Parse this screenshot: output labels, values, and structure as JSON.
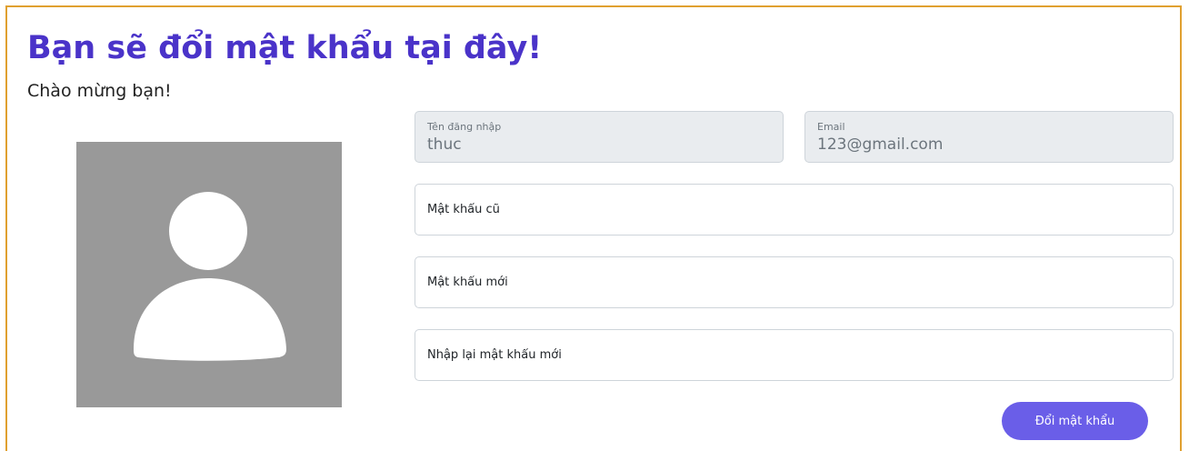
{
  "header": {
    "title": "Bạn sẽ đổi mật khẩu tại đây!",
    "greeting": "Chào mừng bạn!"
  },
  "colors": {
    "title": "#4a33c9",
    "frame_border": "#e0a030",
    "button": "#6a5ee8",
    "avatar_bg": "#999999",
    "readonly_bg": "#e9ecef"
  },
  "avatar": {
    "icon": "user-placeholder-icon"
  },
  "form": {
    "username": {
      "label": "Tên đăng nhập",
      "value": "thuc"
    },
    "email": {
      "label": "Email",
      "value": "123@gmail.com"
    },
    "old_password": {
      "placeholder": "Mật khẩu cũ"
    },
    "new_password": {
      "placeholder": "Mật khẩu mới"
    },
    "confirm_password": {
      "placeholder": "Nhập lại mật khẩu mới"
    },
    "submit_label": "Đổi mật khẩu"
  }
}
